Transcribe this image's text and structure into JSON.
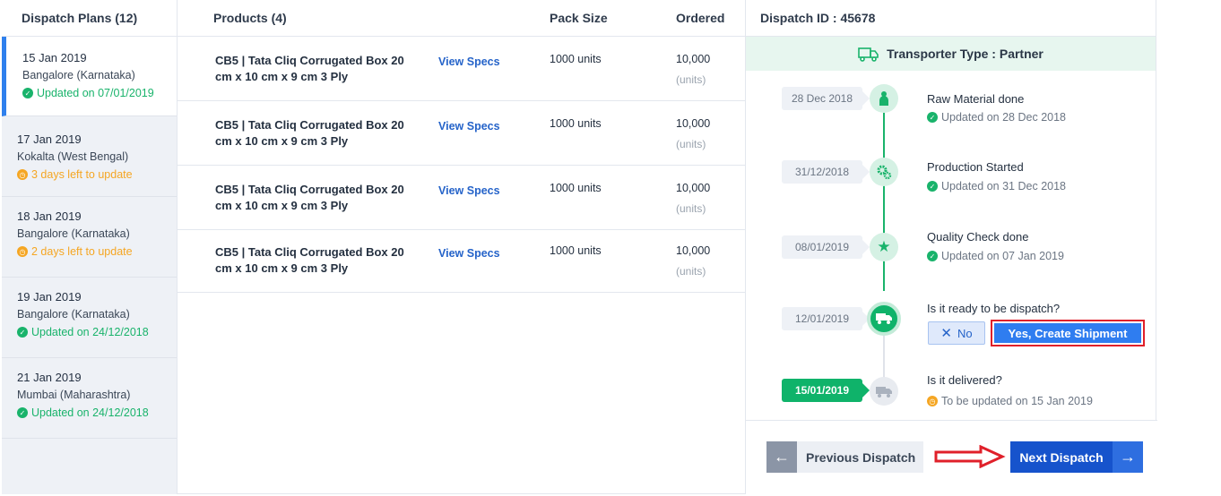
{
  "plans_panel": {
    "title": "Dispatch Plans (12)",
    "items": [
      {
        "date": "15 Jan 2019",
        "city": "Bangalore (Karnataka)",
        "status": "Updated on 07/01/2019",
        "status_type": "ok"
      },
      {
        "date": "17 Jan 2019",
        "city": "Kokalta (West Bengal)",
        "status": "3 days left to update",
        "status_type": "warn"
      },
      {
        "date": "18 Jan 2019",
        "city": "Bangalore (Karnataka)",
        "status": "2 days left to update",
        "status_type": "warn"
      },
      {
        "date": "19 Jan 2019",
        "city": "Bangalore (Karnataka)",
        "status": "Updated on 24/12/2018",
        "status_type": "ok"
      },
      {
        "date": "21 Jan 2019",
        "city": "Mumbai (Maharashtra)",
        "status": "Updated on 24/12/2018",
        "status_type": "ok"
      }
    ]
  },
  "products_panel": {
    "columns": {
      "products": "Products (4)",
      "pack_size": "Pack Size",
      "ordered": "Ordered"
    },
    "rows": [
      {
        "name": "CB5 | Tata Cliq Corrugated Box 20 cm x 10 cm x 9 cm 3 Ply",
        "specs_link": "View Specs",
        "pack_size": "1000 units",
        "ordered": "10,000",
        "ordered_unit": "(units)"
      },
      {
        "name": "CB5 | Tata Cliq Corrugated Box 20 cm x 10 cm x 9 cm 3 Ply",
        "specs_link": "View Specs",
        "pack_size": "1000 units",
        "ordered": "10,000",
        "ordered_unit": "(units)"
      },
      {
        "name": "CB5 | Tata Cliq Corrugated Box 20 cm x 10 cm x 9 cm 3 Ply",
        "specs_link": "View Specs",
        "pack_size": "1000 units",
        "ordered": "10,000",
        "ordered_unit": "(units)"
      },
      {
        "name": "CB5 | Tata Cliq Corrugated Box 20 cm x 10 cm x 9 cm 3 Ply",
        "specs_link": "View Specs",
        "pack_size": "1000 units",
        "ordered": "10,000",
        "ordered_unit": "(units)"
      }
    ]
  },
  "dispatch_panel": {
    "title": "Dispatch ID : 45678",
    "transporter": "Transporter Type : Partner",
    "timeline": [
      {
        "date": "28 Dec 2018",
        "title": "Raw Material done",
        "sub": "Updated on 28 Dec 2018",
        "icon": "worker-icon"
      },
      {
        "date": "31/12/2018",
        "title": "Production Started",
        "sub": "Updated on 31 Dec 2018",
        "icon": "gears-icon"
      },
      {
        "date": "08/01/2019",
        "title": "Quality Check done",
        "sub": "Updated on 07 Jan 2019",
        "icon": "star-icon"
      },
      {
        "date": "12/01/2019",
        "title": "Is it ready to be dispatch?",
        "icon": "truck-icon"
      },
      {
        "date": "15/01/2019",
        "title": "Is it delivered?",
        "sub": "To be updated on 15 Jan 2019",
        "icon": "delivery-truck-icon"
      }
    ],
    "no_button": "No",
    "yes_button": "Yes, Create Shipment",
    "prev_button": "Previous Dispatch",
    "next_button": "Next Dispatch"
  },
  "colors": {
    "accent": "#2f80ed",
    "success": "#19b36b",
    "warning": "#f5a623",
    "primary_dark": "#1653cc",
    "highlight": "#e0202a"
  }
}
